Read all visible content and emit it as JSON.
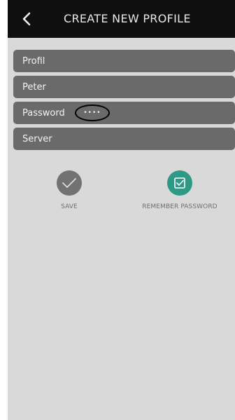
{
  "header": {
    "title": "CREATE NEW PROFILE",
    "back_icon": "chevron-left-icon"
  },
  "fields": {
    "profile": {
      "label": "Profil"
    },
    "name": {
      "label": "Peter"
    },
    "password": {
      "label": "Password",
      "value": "••••"
    },
    "server": {
      "label": "Server"
    }
  },
  "actions": {
    "save": {
      "label": "SAVE",
      "icon": "checkmark-icon",
      "color": "#727272"
    },
    "remember_password": {
      "label": "REMEMBER PASSWORD",
      "icon": "checkbox-checked-icon",
      "color": "#2e9a86"
    }
  },
  "colors": {
    "header_bg": "#0f0f0f",
    "screen_bg": "#d9d9d9",
    "field_bg": "#6a6a6a",
    "annotation_circle": "#000000"
  }
}
